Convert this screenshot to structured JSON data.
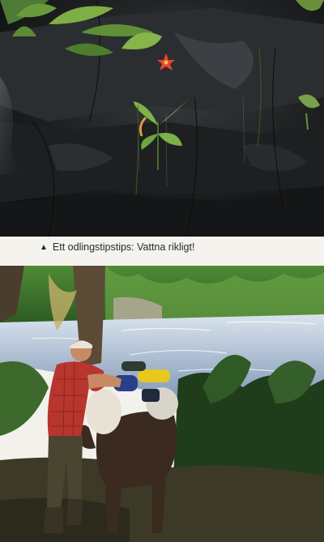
{
  "caption": {
    "marker_icon": "triangle-up-icon",
    "text": "Ett odlingstipstips: Vattna rikligt!"
  },
  "colors": {
    "page_background": "#f2f1ec",
    "caption_text": "#2a2a2a",
    "rock": "#1c1e1f",
    "flower": "#e8462e",
    "river": "#c8d6e6",
    "foliage": "#3f7a2a"
  }
}
